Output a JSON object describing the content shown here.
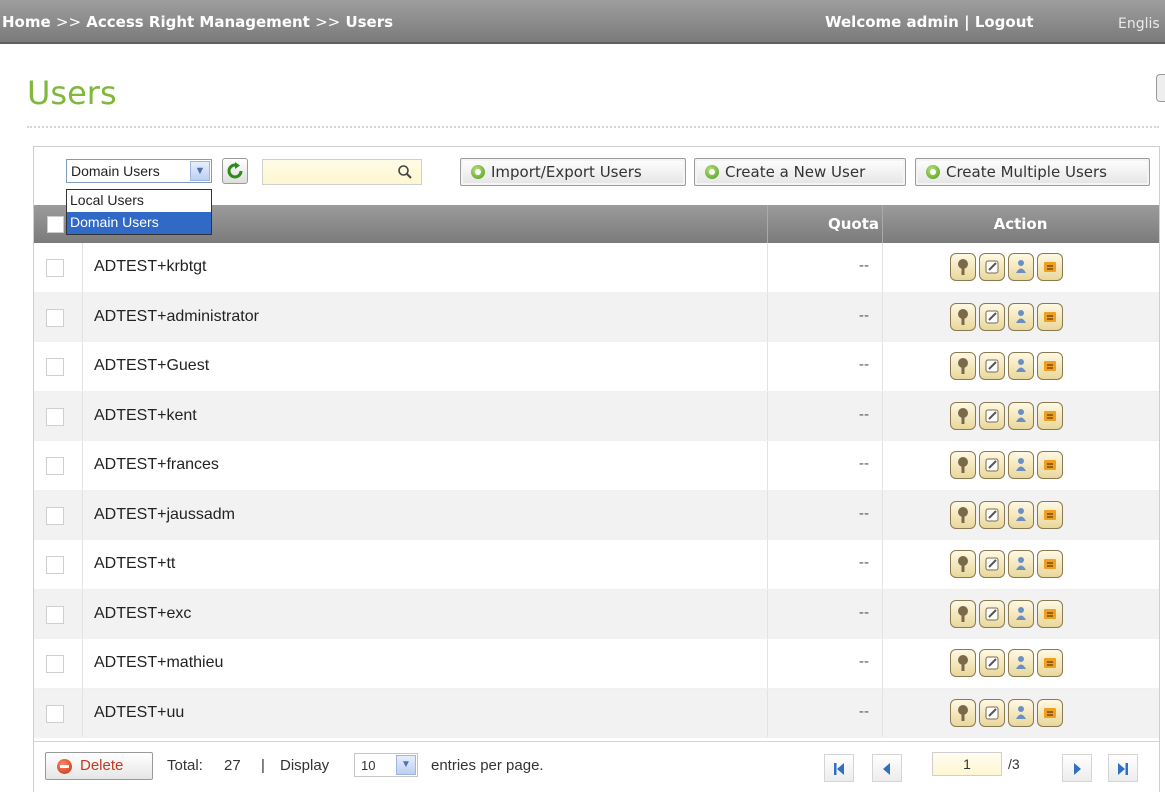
{
  "breadcrumb": {
    "home": "Home",
    "sep": ">>",
    "section": "Access Right Management",
    "current": "Users"
  },
  "header": {
    "welcome": "Welcome admin",
    "divider": "|",
    "logout": "Logout",
    "language": "Englis"
  },
  "page": {
    "title": "Users"
  },
  "toolbar": {
    "user_type_selected": "Domain Users",
    "user_type_options": [
      "Local Users",
      "Domain Users"
    ],
    "search_placeholder": "",
    "import_export_label": "Import/Export Users",
    "create_user_label": "Create a New User",
    "create_multiple_label": "Create Multiple Users"
  },
  "table": {
    "columns": {
      "quota": "Quota",
      "action": "Action"
    },
    "rows": [
      {
        "name": "ADTEST+krbtgt",
        "quota": "--"
      },
      {
        "name": "ADTEST+administrator",
        "quota": "--"
      },
      {
        "name": "ADTEST+Guest",
        "quota": "--"
      },
      {
        "name": "ADTEST+kent",
        "quota": "--"
      },
      {
        "name": "ADTEST+frances",
        "quota": "--"
      },
      {
        "name": "ADTEST+jaussadm",
        "quota": "--"
      },
      {
        "name": "ADTEST+tt",
        "quota": "--"
      },
      {
        "name": "ADTEST+exc",
        "quota": "--"
      },
      {
        "name": "ADTEST+mathieu",
        "quota": "--"
      },
      {
        "name": "ADTEST+uu",
        "quota": "--"
      }
    ],
    "row_action_icons": [
      "password-icon",
      "edit-icon",
      "user-group-icon",
      "folder-permission-icon"
    ]
  },
  "footer": {
    "delete_label": "Delete",
    "total_label": "Total:",
    "total_value": "27",
    "divider": "|",
    "display_label": "Display",
    "per_page_value": "10",
    "entries_label": "entries per page.",
    "current_page": "1",
    "total_pages": "/3"
  },
  "colors": {
    "title_green": "#7fb83b",
    "header_gray": "#8a8a8a",
    "selected_blue": "#3169c6"
  }
}
